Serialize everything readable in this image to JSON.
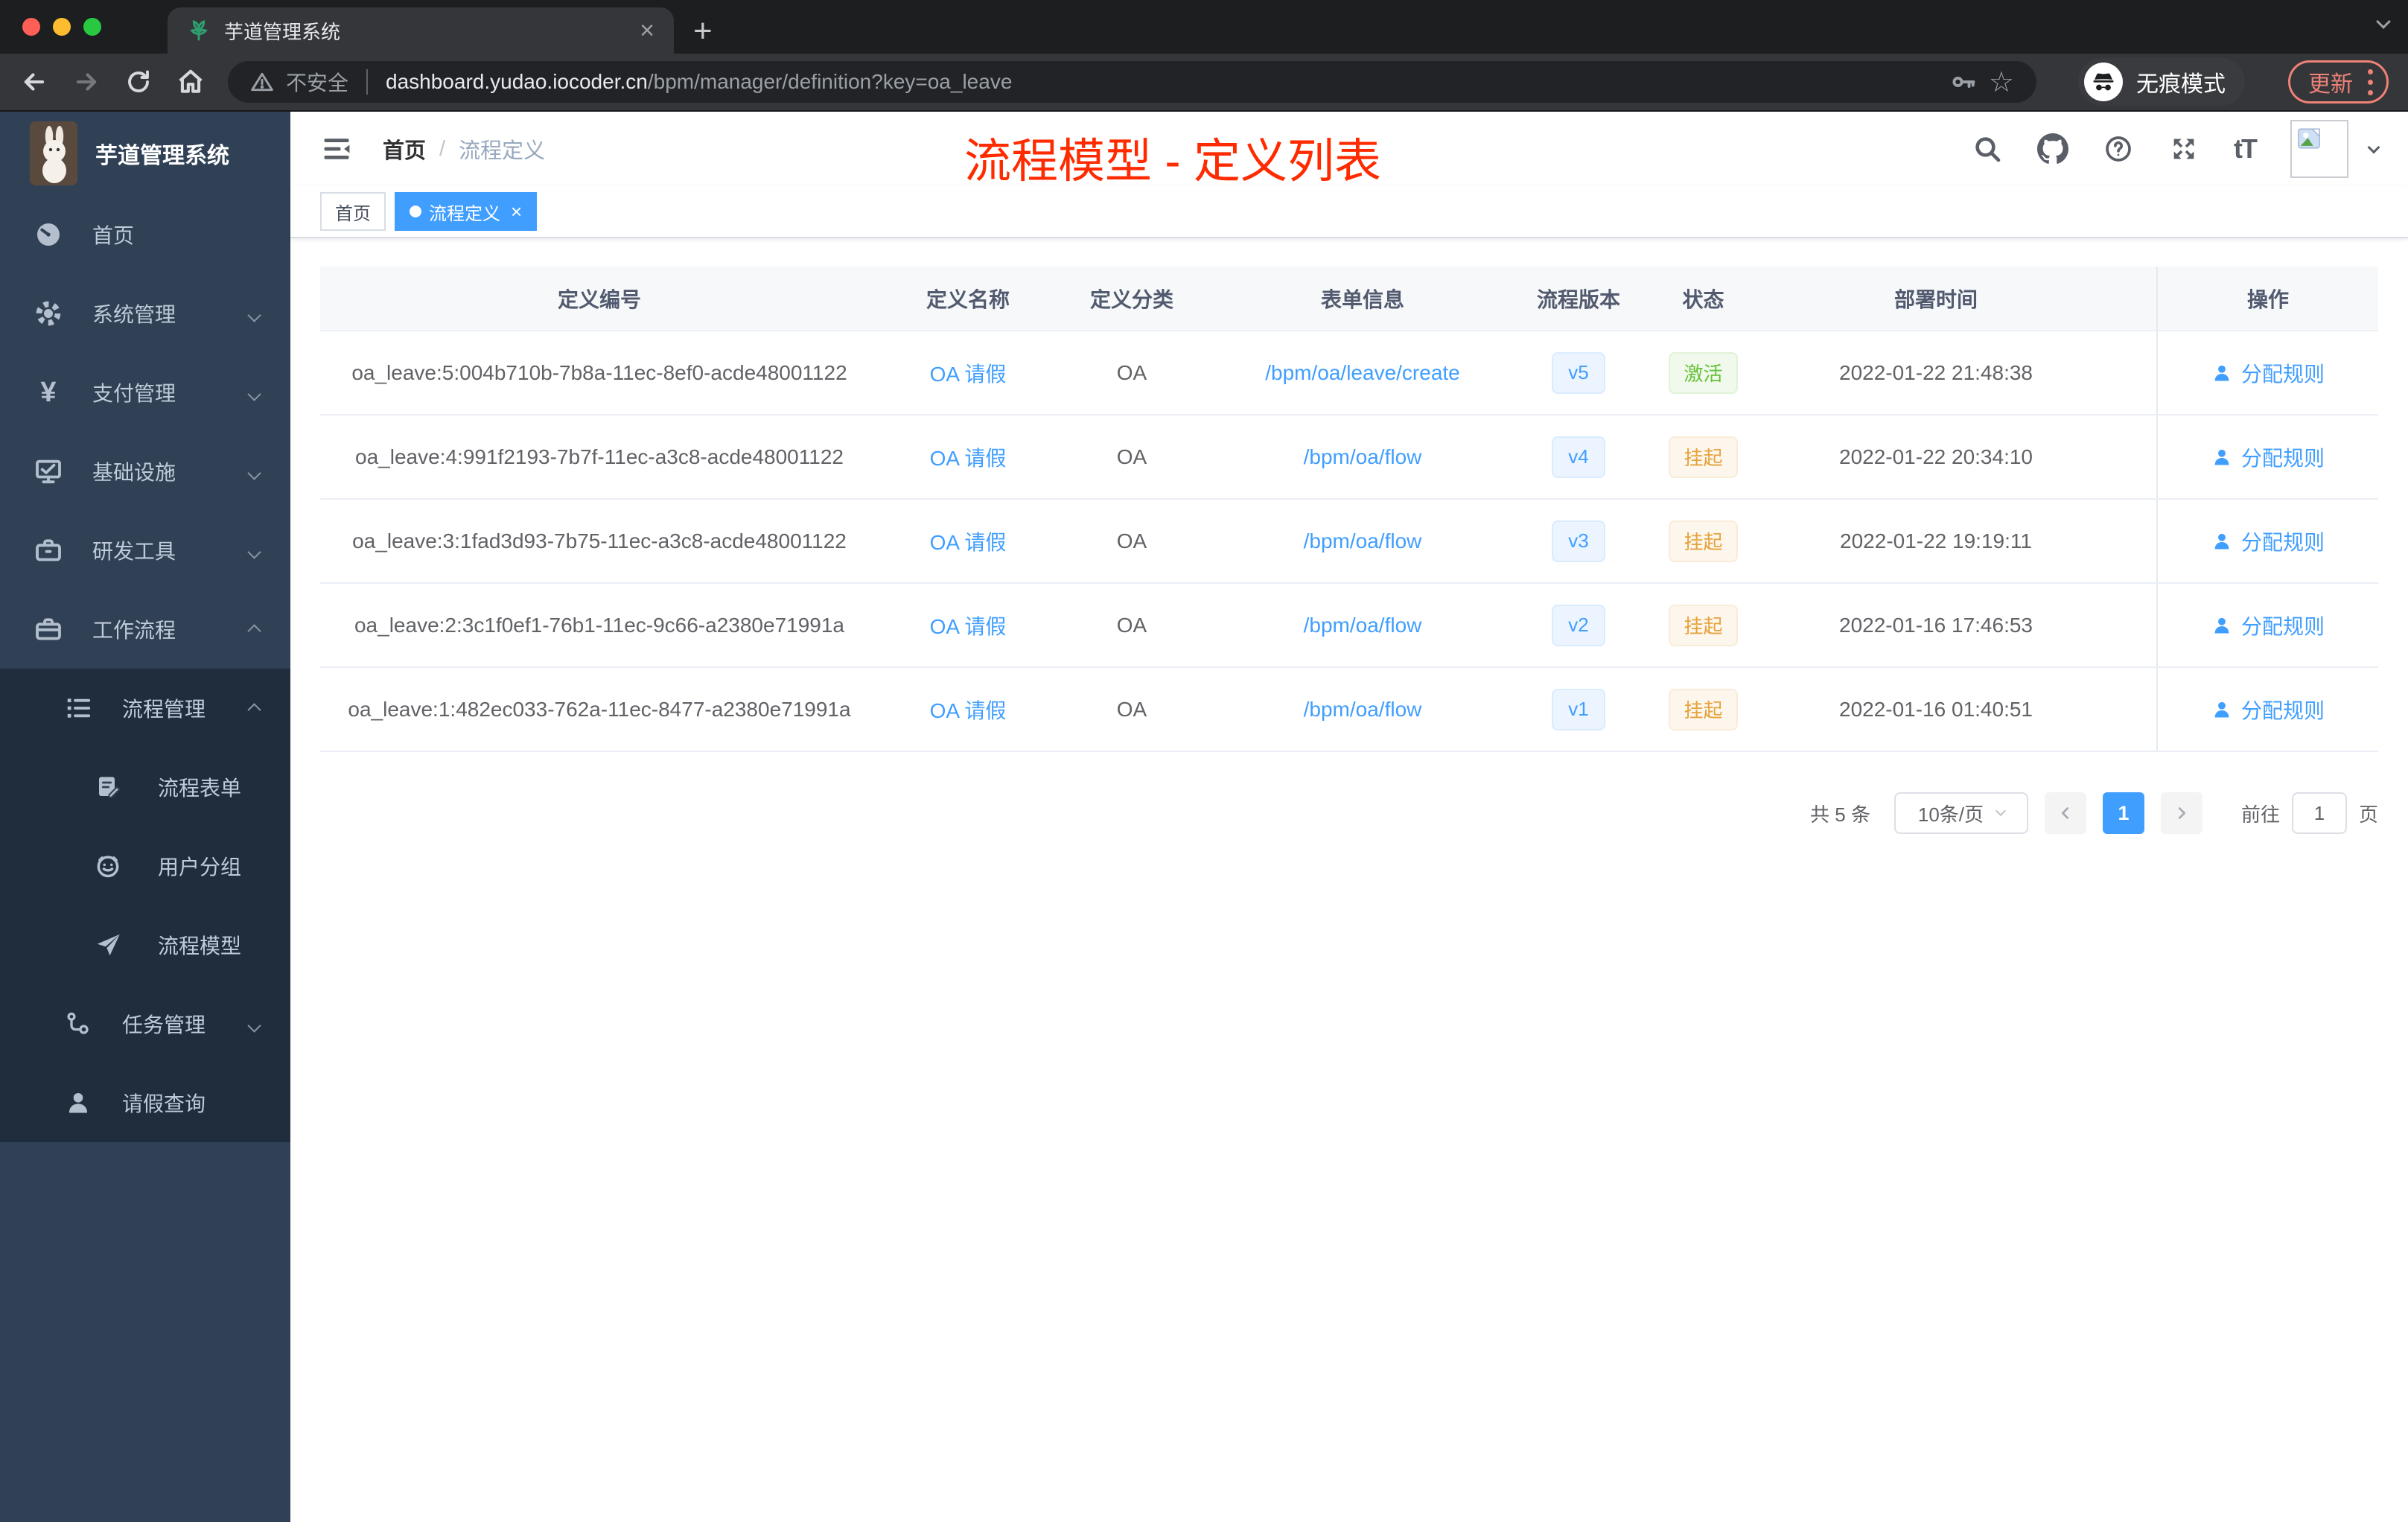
{
  "browser": {
    "tab": {
      "title": "芋道管理系统",
      "close_glyph": "×",
      "new_tab_glyph": "+"
    },
    "address": {
      "security": "不安全",
      "host": "dashboard.yudao.iocoder.cn",
      "path": "/bpm/manager/definition?key=oa_leave"
    },
    "incognito_label": "无痕模式",
    "update_label": "更新"
  },
  "sidebar": {
    "logo_title": "芋道管理系统",
    "items": [
      {
        "label": "首页"
      },
      {
        "label": "系统管理"
      },
      {
        "label": "支付管理"
      },
      {
        "label": "基础设施"
      },
      {
        "label": "研发工具"
      },
      {
        "label": "工作流程"
      },
      {
        "label": "流程管理"
      },
      {
        "label": "流程表单"
      },
      {
        "label": "用户分组"
      },
      {
        "label": "流程模型"
      },
      {
        "label": "任务管理"
      },
      {
        "label": "请假查询"
      }
    ]
  },
  "navbar": {
    "breadcrumb_home": "首页",
    "breadcrumb_sep": "/",
    "breadcrumb_current": "流程定义",
    "annotation": "流程模型 - 定义列表"
  },
  "tags": {
    "home": "首页",
    "active": "流程定义",
    "close_glyph": "×"
  },
  "table": {
    "columns": [
      "定义编号",
      "定义名称",
      "定义分类",
      "表单信息",
      "流程版本",
      "状态",
      "部署时间",
      "操作"
    ],
    "rows": [
      {
        "id": "oa_leave:5:004b710b-7b8a-11ec-8ef0-acde48001122",
        "name": "OA 请假",
        "category": "OA",
        "form": "/bpm/oa/leave/create",
        "version": "v5",
        "status": "激活",
        "deployed": "2022-01-22 21:48:38",
        "action": "分配规则"
      },
      {
        "id": "oa_leave:4:991f2193-7b7f-11ec-a3c8-acde48001122",
        "name": "OA 请假",
        "category": "OA",
        "form": "/bpm/oa/flow",
        "version": "v4",
        "status": "挂起",
        "deployed": "2022-01-22 20:34:10",
        "action": "分配规则"
      },
      {
        "id": "oa_leave:3:1fad3d93-7b75-11ec-a3c8-acde48001122",
        "name": "OA 请假",
        "category": "OA",
        "form": "/bpm/oa/flow",
        "version": "v3",
        "status": "挂起",
        "deployed": "2022-01-22 19:19:11",
        "action": "分配规则"
      },
      {
        "id": "oa_leave:2:3c1f0ef1-76b1-11ec-9c66-a2380e71991a",
        "name": "OA 请假",
        "category": "OA",
        "form": "/bpm/oa/flow",
        "version": "v2",
        "status": "挂起",
        "deployed": "2022-01-16 17:46:53",
        "action": "分配规则"
      },
      {
        "id": "oa_leave:1:482ec033-762a-11ec-8477-a2380e71991a",
        "name": "OA 请假",
        "category": "OA",
        "form": "/bpm/oa/flow",
        "version": "v1",
        "status": "挂起",
        "deployed": "2022-01-16 01:40:51",
        "action": "分配规则"
      }
    ]
  },
  "pagination": {
    "total": "共 5 条",
    "page_size": "10条/页",
    "current_page": "1",
    "goto_label": "前往",
    "goto_value": "1",
    "unit": "页"
  },
  "colors": {
    "accent": "#409eff",
    "annotation": "#ff2b00",
    "success": "#67c23a",
    "warning": "#e6a23c"
  }
}
